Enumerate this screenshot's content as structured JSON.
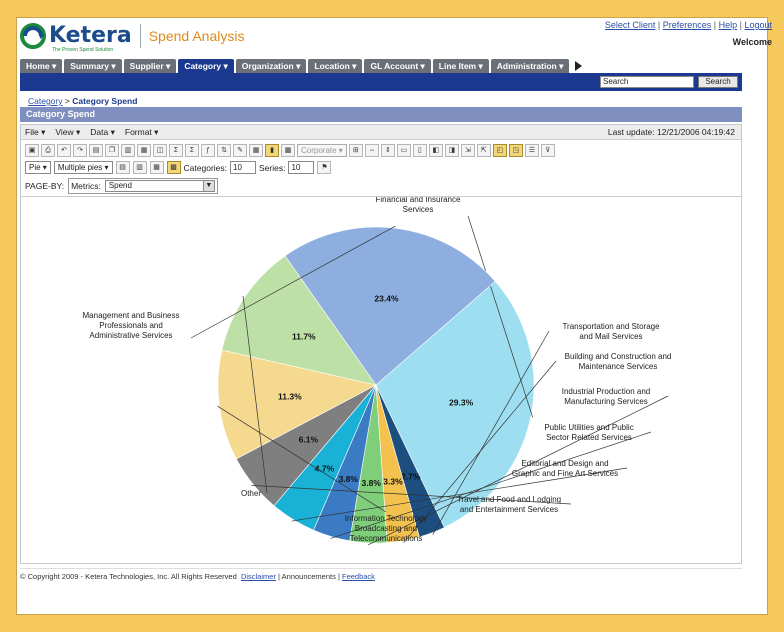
{
  "header": {
    "logo_text": "Ketera",
    "logo_tagline": "The Proven Spend Solution",
    "app_title": "Spend Analysis",
    "links": [
      "Select Client",
      "Preferences",
      "Help",
      "Logout"
    ],
    "welcome": "Welcome"
  },
  "nav": {
    "tabs": [
      "Home",
      "Summary",
      "Supplier",
      "Category",
      "Organization",
      "Location",
      "GL Account",
      "Line Item",
      "Administration"
    ],
    "active": "Category"
  },
  "search": {
    "placeholder": "Search",
    "button_label": "Search"
  },
  "breadcrumb": {
    "link": "Category",
    "sep": ">",
    "current": "Category Spend"
  },
  "page_title": "Category Spend",
  "menubar": {
    "items": [
      "File",
      "View",
      "Data",
      "Format"
    ],
    "last_update": "Last update: 12/21/2006 04:19:42"
  },
  "toolbar": {
    "corporate_label": "Corporate",
    "chart_type": "Pie",
    "pie_mode": "Multiple pies",
    "categories_label": "Categories:",
    "categories_value": "10",
    "series_label": "Series:",
    "series_value": "10"
  },
  "pageby": {
    "label": "PAGE-BY:",
    "metrics_label": "Metrics:",
    "metrics_value": "Spend"
  },
  "chart_data": {
    "type": "pie",
    "slices": [
      {
        "label": "Financial and Insurance Services",
        "value": 29.3,
        "display": "29.3%",
        "color": "#9ddff0"
      },
      {
        "label": "Transportation and Storage and Mail Services",
        "value": 2.7,
        "display": "2.7%",
        "color": "#1c4f80"
      },
      {
        "label": "Building and Construction and Maintenance Services",
        "value": 3.3,
        "display": "3.3%",
        "color": "#f2c14e"
      },
      {
        "label": "Industrial Production and Manufacturing Services",
        "value": 3.8,
        "display": "3.8%",
        "color": "#7fcf7a"
      },
      {
        "label": "Public Utilities and Public Sector Related Services",
        "value": 3.8,
        "display": "3.8%",
        "color": "#3a7bc4"
      },
      {
        "label": "Editorial and Design and Graphic and Fine Art Services",
        "value": 4.7,
        "display": "4.7%",
        "color": "#19b2d6"
      },
      {
        "label": "Travel and Food and Lodging and Entertainment Services",
        "value": 6.1,
        "display": "6.1%",
        "color": "#7f7f7f"
      },
      {
        "label": "Information Technology Broadcasting and Telecommunications",
        "value": 11.3,
        "display": "11.3%",
        "color": "#f5d98e"
      },
      {
        "label": "Other",
        "value": 11.7,
        "display": "11.7%",
        "color": "#bde0a6"
      },
      {
        "label": "Management and Business Professionals and Administrative Services",
        "value": 23.4,
        "display": "23.4%",
        "color": "#8eaee0"
      }
    ]
  },
  "footer": {
    "copyright": "© Copyright 2009 - Ketera Technologies, Inc. All Rights Reserved",
    "disclaimer": "Disclaimer",
    "announcements": "Announcements",
    "feedback": "Feedback"
  }
}
